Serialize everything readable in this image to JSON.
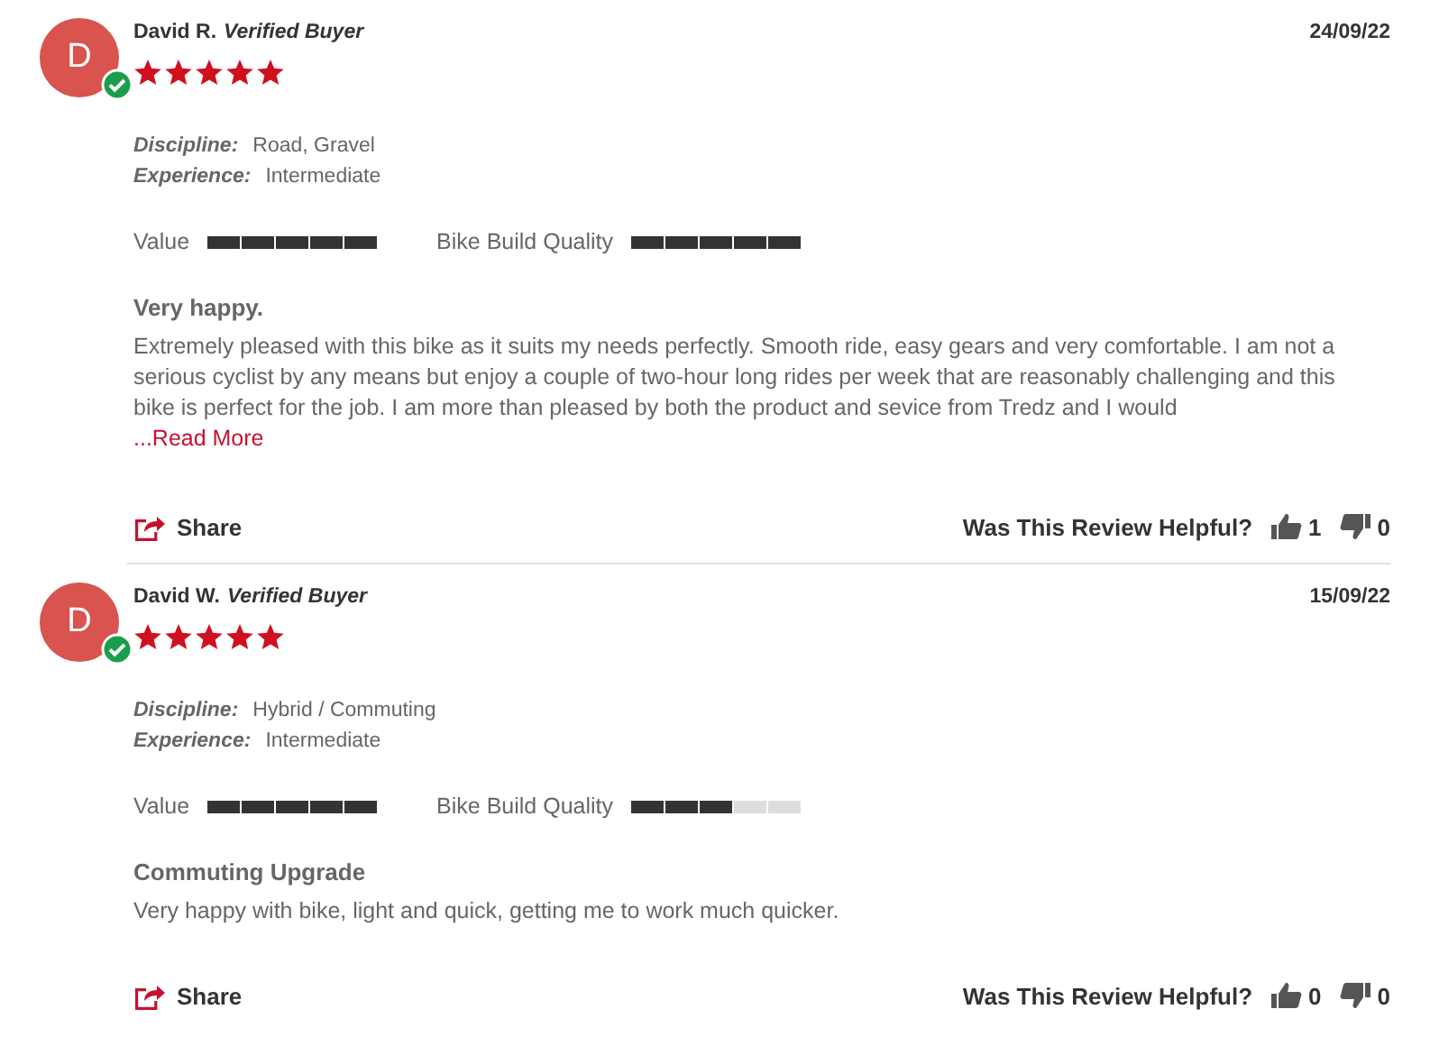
{
  "reviews": [
    {
      "initial": "D",
      "verified": true,
      "name": "David R.",
      "badge": "Verified Buyer",
      "date": "24/09/22",
      "stars": 5,
      "details": [
        {
          "label": "Discipline:",
          "value": "Road, Gravel"
        },
        {
          "label": "Experience:",
          "value": "Intermediate"
        }
      ],
      "ratings": [
        {
          "label": "Value",
          "level": 1
        },
        {
          "label": "Bike Build Quality",
          "level": 1
        }
      ],
      "title": "Very happy.",
      "body": "Extremely pleased with this bike as it suits my needs perfectly. Smooth ride, easy gears and very comfortable. I am not a serious cyclist by any means but enjoy a couple of two-hour long rides per week that are reasonably challenging and this bike is perfect for the job. I am more than pleased by both the product and sevice from Tredz and I would",
      "read_more": "...Read More",
      "share": "Share",
      "helpful_question": "Was This Review Helpful?",
      "up_count": "1",
      "down_count": "0"
    },
    {
      "initial": "D",
      "verified": true,
      "name": "David W.",
      "badge": "Verified Buyer",
      "date": "15/09/22",
      "stars": 5,
      "details": [
        {
          "label": "Discipline:",
          "value": "Hybrid / Commuting"
        },
        {
          "label": "Experience:",
          "value": "Intermediate"
        }
      ],
      "ratings": [
        {
          "label": "Value",
          "level": 1
        },
        {
          "label": "Bike Build Quality",
          "level": 0.6
        }
      ],
      "title": "Commuting Upgrade",
      "body": "Very happy with bike, light and quick, getting me to work much quicker.",
      "share": "Share",
      "helpful_question": "Was This Review Helpful?",
      "up_count": "0",
      "down_count": "0"
    }
  ]
}
